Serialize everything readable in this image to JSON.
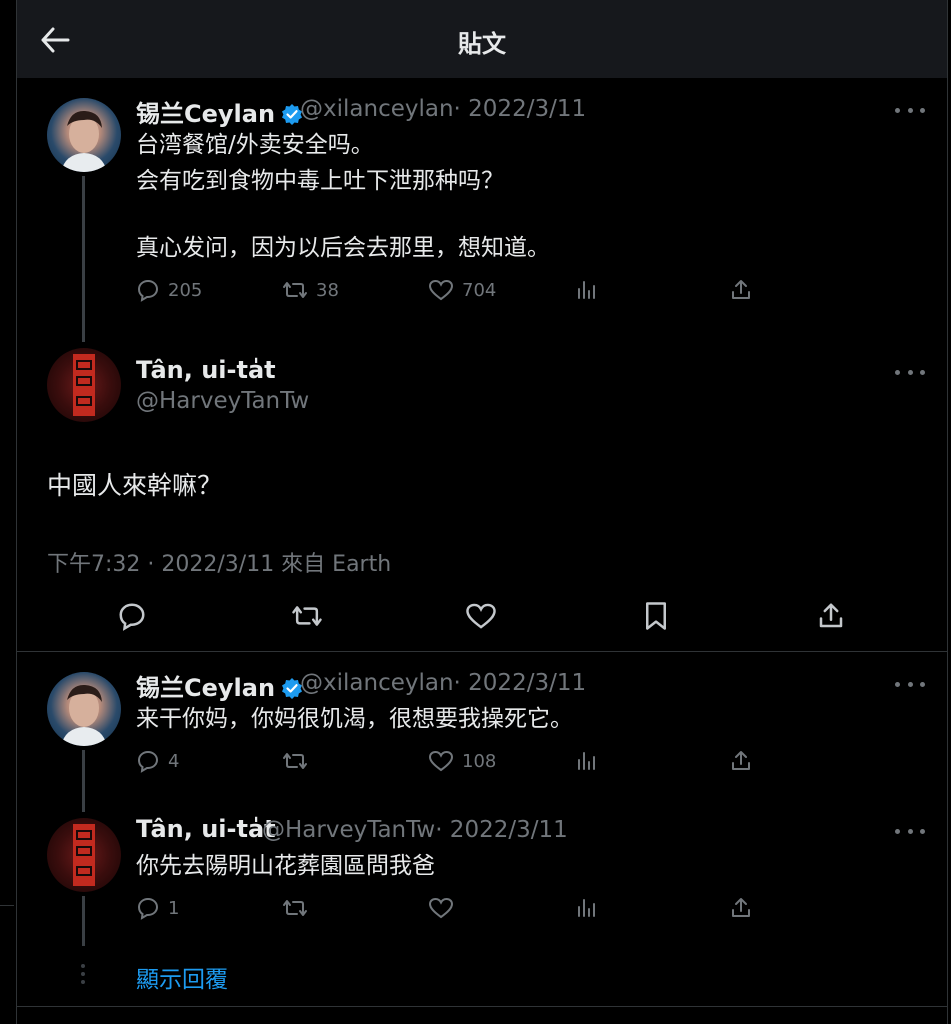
{
  "header": {
    "title": "貼文"
  },
  "original_tweet": {
    "name": "锡兰Ceylan",
    "handle": "@xilanceylan",
    "date": "· 2022/3/11",
    "lines": [
      "台湾餐馆/外卖安全吗。",
      "会有吃到食物中毒上吐下泄那种吗？",
      "",
      "真心发问，因为以后会去那里，想知道。"
    ],
    "replies": "205",
    "retweets": "38",
    "likes": "704"
  },
  "main_tweet": {
    "name": "Tân, ui-ta̍t",
    "handle": "@HarveyTanTw",
    "text": "中國人來幹嘛？",
    "meta": "下午7:32 · 2022/3/11 來自 Earth"
  },
  "reply1": {
    "name": "锡兰Ceylan",
    "handle": "@xilanceylan",
    "date": "· 2022/3/11",
    "text": "来干你妈，你妈很饥渴，很想要我操死它。",
    "replies": "4",
    "likes": "108"
  },
  "reply2": {
    "name": "Tân, ui-ta̍t",
    "handle": "@HarveyTanTw",
    "date": "· 2022/3/11",
    "text": "你先去陽明山花葬園區問我爸",
    "replies": "1"
  },
  "show_replies": "顯示回覆",
  "colors": {
    "background": "#000000",
    "text": "#e7e9ea",
    "muted": "#71767b",
    "accent": "#1d9bf0"
  }
}
